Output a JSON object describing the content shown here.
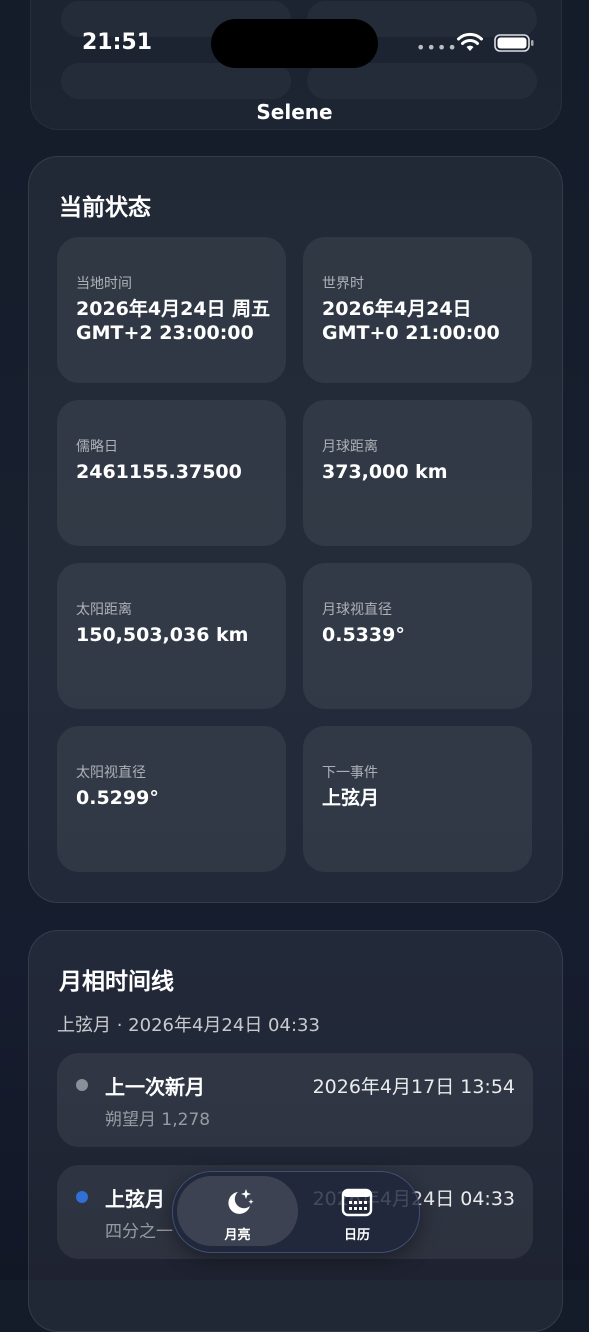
{
  "app": {
    "title": "Selene"
  },
  "status_bar": {
    "time": "21:51"
  },
  "current_state": {
    "title": "当前状态",
    "tiles": [
      {
        "label": "当地时间",
        "value": "2026年4月24日 周五 GMT+2 23:00:00"
      },
      {
        "label": "世界时",
        "value": "2026年4月24日 GMT+0 21:00:00"
      },
      {
        "label": "儒略日",
        "value": "2461155.37500"
      },
      {
        "label": "月球距离",
        "value": "373,000 km"
      },
      {
        "label": "太阳距离",
        "value": "150,503,036 km"
      },
      {
        "label": "月球视直径",
        "value": "0.5339°"
      },
      {
        "label": "太阳视直径",
        "value": "0.5299°"
      },
      {
        "label": "下一事件",
        "value": "上弦月"
      }
    ]
  },
  "timeline": {
    "title": "月相时间线",
    "subtitle": "上弦月 · 2026年4月24日 04:33",
    "events": [
      {
        "name": "上一次新月",
        "date": "2026年4月17日 13:54",
        "detail": "朔望月 1,278",
        "dot_color": "#8a8f99"
      },
      {
        "name": "上弦月",
        "date": "2026年4月24日 04:33",
        "detail": "四分之一",
        "dot_color": "#2f6fd6"
      }
    ]
  },
  "tabbar": {
    "tabs": [
      {
        "label": "月亮",
        "icon": "moon-stars-icon",
        "active": true
      },
      {
        "label": "日历",
        "icon": "calendar-icon",
        "active": false
      }
    ]
  }
}
